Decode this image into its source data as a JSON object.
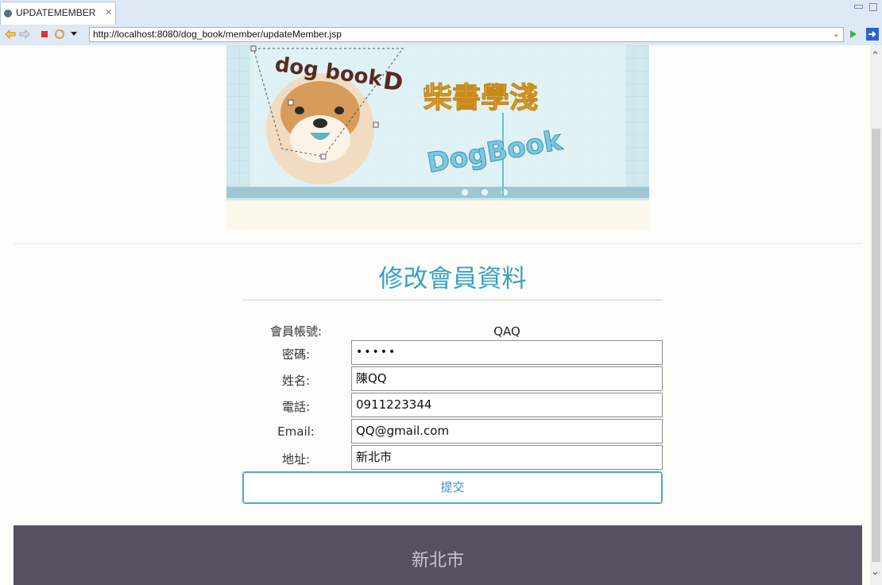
{
  "tab": {
    "title": "UPDATEMEMBER",
    "close": "✕"
  },
  "toolbar": {
    "url": "http://localhost:8080/dog_book/member/updateMember.jsp"
  },
  "banner": {
    "logo_text": "dog book",
    "logo_letter": "D",
    "cjk_title": "柴書學淺",
    "brand": "DogBook"
  },
  "form": {
    "title": "修改會員資料",
    "account_label": "會員帳號:",
    "account_value": "QAQ",
    "password_label": "密碼:",
    "password_value": "•••••",
    "name_label": "姓名:",
    "name_value": "陳QQ",
    "phone_label": "電話:",
    "phone_value": "0911223344",
    "email_label": "Email:",
    "email_value": "QQ@gmail.com",
    "address_label": "地址:",
    "address_value": "新北市",
    "submit_label": "提交"
  },
  "footer": {
    "text": "新北市"
  },
  "colors": {
    "accent": "#3aa0c6",
    "footer_bg": "#575063",
    "tab_bar": "#dfe8f5"
  },
  "icons": [
    "globe-icon",
    "back-icon",
    "forward-icon",
    "stop-icon",
    "refresh-icon",
    "menu-dropdown-icon",
    "url-dropdown-icon",
    "go-icon",
    "external-browser-icon",
    "minimize-icon",
    "maximize-icon",
    "scroll-up-icon",
    "scroll-down-icon"
  ]
}
